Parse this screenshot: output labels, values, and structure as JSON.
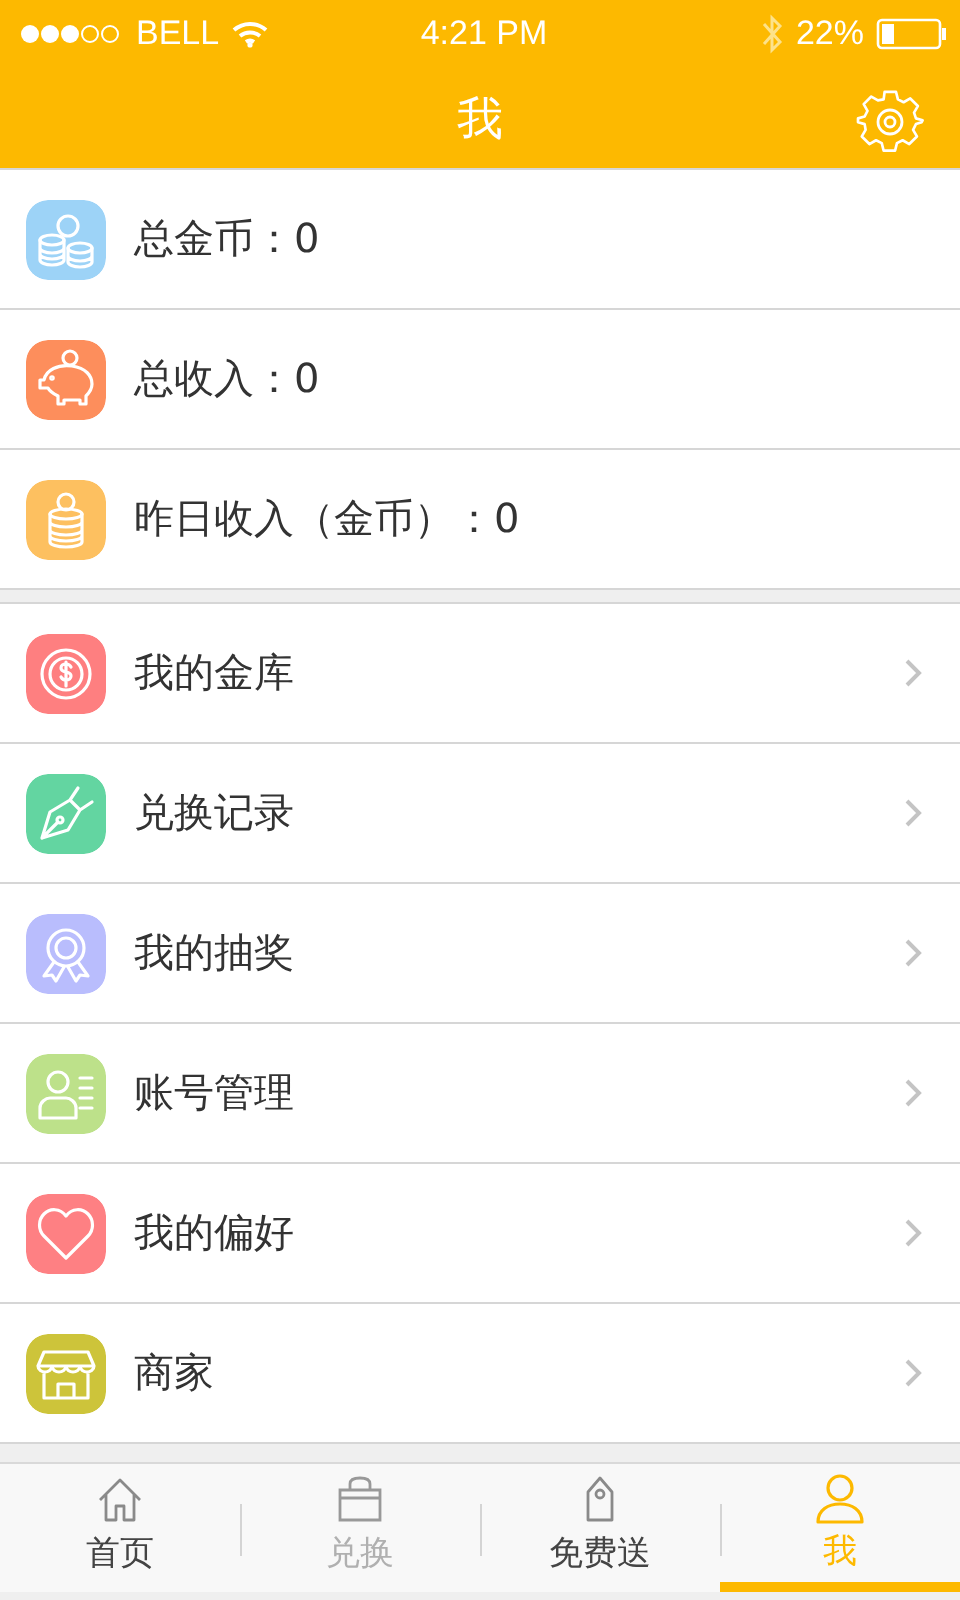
{
  "status_bar": {
    "carrier": "BELL",
    "time": "4:21 PM",
    "battery": "22%"
  },
  "nav": {
    "title": "我"
  },
  "stats": [
    {
      "label": "总金币：0",
      "kind": "coins",
      "color": "#9dd3f7"
    },
    {
      "label": "总收入：0",
      "kind": "piggy",
      "color": "#fd8e5c"
    },
    {
      "label": "昨日收入（金币）：0",
      "kind": "stack",
      "color": "#fdc060"
    }
  ],
  "menu": [
    {
      "label": "我的金库",
      "kind": "dollar",
      "color": "#fe7f80"
    },
    {
      "label": "兑换记录",
      "kind": "pen",
      "color": "#63d5a1"
    },
    {
      "label": "我的抽奖",
      "kind": "award",
      "color": "#b9bdfd"
    },
    {
      "label": "账号管理",
      "kind": "contact",
      "color": "#bde18a"
    },
    {
      "label": "我的偏好",
      "kind": "heart",
      "color": "#fe8083"
    },
    {
      "label": "商家",
      "kind": "store",
      "color": "#cdc43a"
    }
  ],
  "tabs": [
    {
      "label": "首页",
      "kind": "home",
      "selected": false,
      "disabled": false
    },
    {
      "label": "兑换",
      "kind": "bag",
      "selected": false,
      "disabled": true
    },
    {
      "label": "免费送",
      "kind": "tag",
      "selected": false,
      "disabled": false
    },
    {
      "label": "我",
      "kind": "person",
      "selected": true,
      "disabled": false
    }
  ]
}
